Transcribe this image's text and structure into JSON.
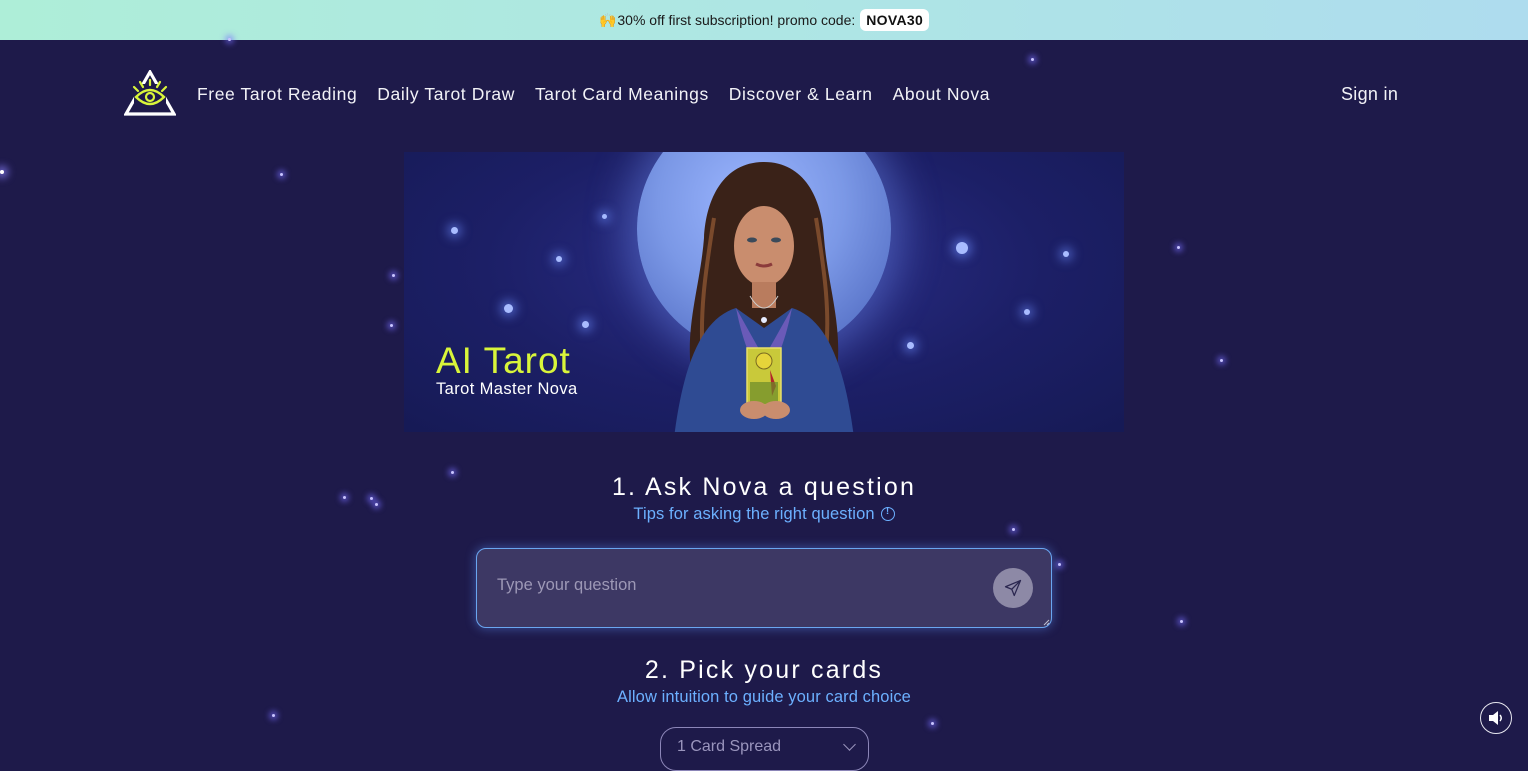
{
  "promo": {
    "emoji": "🙌",
    "text": "30% off first subscription! promo code:",
    "code": "NOVA30"
  },
  "nav": {
    "logo": "eye-triangle-logo",
    "links": [
      {
        "label": "Free Tarot Reading"
      },
      {
        "label": "Daily Tarot Draw"
      },
      {
        "label": "Tarot Card Meanings"
      },
      {
        "label": "Discover & Learn"
      },
      {
        "label": "About Nova"
      }
    ],
    "sign_in": "Sign in"
  },
  "hero": {
    "title": "AI Tarot",
    "subtitle": "Tarot Master Nova",
    "image": "tarot-reader-with-moon-and-card"
  },
  "step1": {
    "title": "1. Ask Nova a question",
    "tips_link": "Tips for asking the right question",
    "tips_icon": "info-icon",
    "input": {
      "value": "",
      "placeholder": "Type your question"
    },
    "send_icon": "send-paper-plane-icon"
  },
  "step2": {
    "title": "2. Pick your cards",
    "subtitle": "Allow intuition to guide your card choice",
    "spread_select": {
      "selected": "1 Card Spread"
    }
  },
  "sound": {
    "icon": "speaker-icon"
  },
  "colors": {
    "background": "#1e1a4a",
    "accent_yellow": "#d9f53a",
    "link_blue": "#6cb0ff",
    "promo_start": "#aeeed8",
    "promo_end": "#aedcee",
    "input_bg": "#3d3864",
    "input_border": "#6aa6f0"
  }
}
